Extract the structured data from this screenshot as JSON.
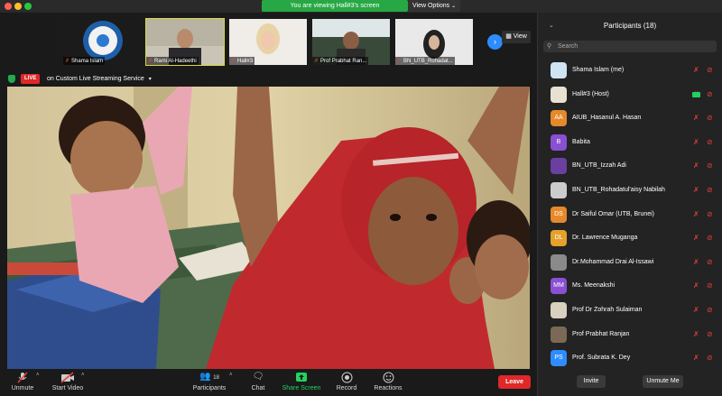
{
  "banner": {
    "viewing": "You are viewing Hall#3's screen",
    "view_options": "View Options"
  },
  "thumbnails": [
    {
      "name": "Shama Islam"
    },
    {
      "name": "Rami Al-Hadeethi"
    },
    {
      "name": "Hall#3"
    },
    {
      "name": "Prof Prabhat Ran..."
    },
    {
      "name": "BN_UTB_Rohadat..."
    }
  ],
  "view_button": "View",
  "live": {
    "badge": "LIVE",
    "label": "on Custom Live Streaming Service"
  },
  "toolbar": {
    "unmute": "Unmute",
    "start_video": "Start Video",
    "participants": "Participants",
    "participant_count": "18",
    "chat": "Chat",
    "share_screen": "Share Screen",
    "record": "Record",
    "reactions": "Reactions",
    "leave": "Leave"
  },
  "panel": {
    "title": "Participants (18)",
    "search_placeholder": "Search",
    "invite": "Invite",
    "unmute_me": "Unmute Me"
  },
  "participants": [
    {
      "name": "Shama Islam (me)",
      "initials": "",
      "color": "#cfe3f3",
      "video": false
    },
    {
      "name": "Hall#3 (Host)",
      "initials": "",
      "color": "#e8e0d0",
      "video": true
    },
    {
      "name": "AIUB_Hasanul A. Hasan",
      "initials": "AA",
      "color": "#e5892b",
      "video": false
    },
    {
      "name": "Babita",
      "initials": "B",
      "color": "#8a4fd3",
      "video": false
    },
    {
      "name": "BN_UTB_Izzah Adi",
      "initials": "",
      "color": "#6a3fa0",
      "video": false
    },
    {
      "name": "BN_UTB_Rohadatul'aisy Nabilah",
      "initials": "",
      "color": "#cccccc",
      "video": false
    },
    {
      "name": "Dr Saiful Omar (UTB, Brunei)",
      "initials": "DS",
      "color": "#e5892b",
      "video": false
    },
    {
      "name": "Dr. Lawrence Muganga",
      "initials": "DL",
      "color": "#e5a12b",
      "video": false
    },
    {
      "name": "Dr.Mohammad Drai Al-Issawi",
      "initials": "",
      "color": "#8a8a8a",
      "video": false
    },
    {
      "name": "Ms. Meenakshi",
      "initials": "MM",
      "color": "#8a4fd3",
      "video": false
    },
    {
      "name": "Prof Dr Zohrah Sulaiman",
      "initials": "",
      "color": "#d9d0c0",
      "video": false
    },
    {
      "name": "Prof Prabhat Ranjan",
      "initials": "",
      "color": "#7a6a55",
      "video": false
    },
    {
      "name": "Prof. Subrata K. Dey",
      "initials": "PS",
      "color": "#2d8cff",
      "video": false
    }
  ]
}
